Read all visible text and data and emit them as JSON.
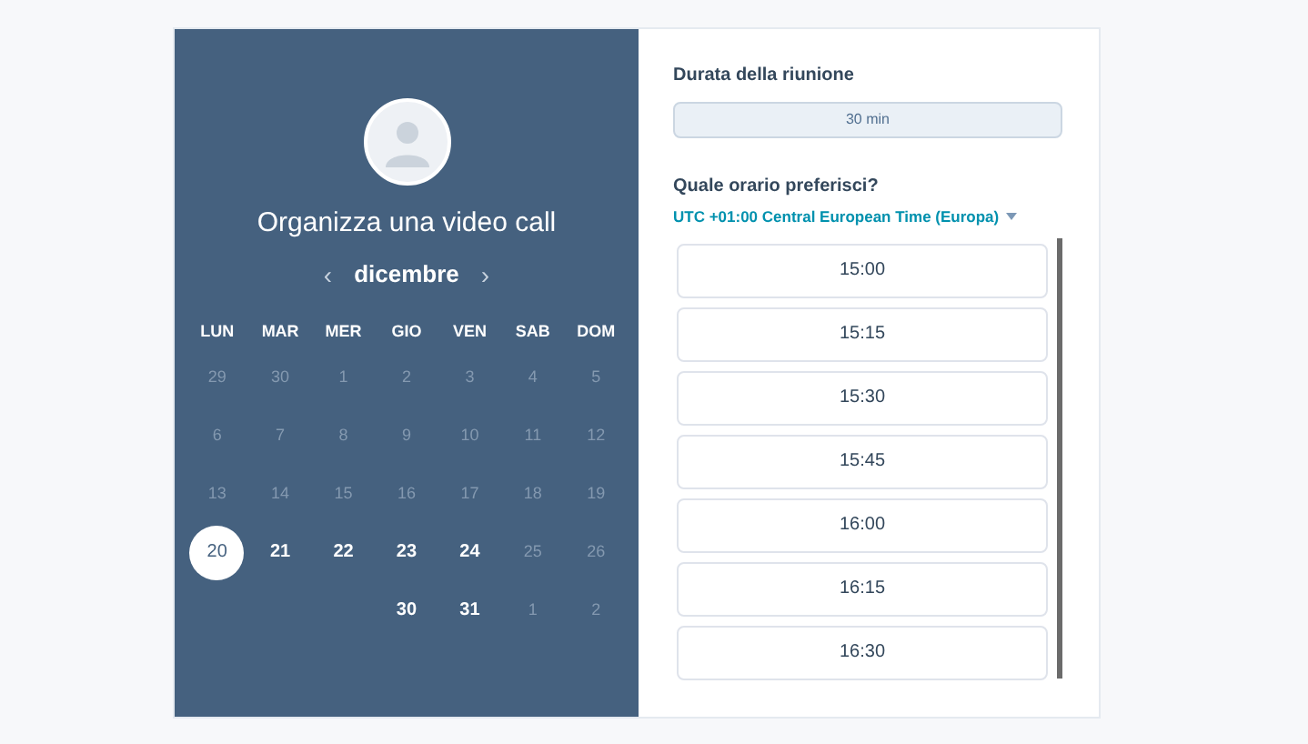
{
  "title": "Organizza una video call",
  "calendar": {
    "month": "dicembre",
    "prev": "‹",
    "next": "›",
    "weekdays": [
      "LUN",
      "MAR",
      "MER",
      "GIO",
      "VEN",
      "SAB",
      "DOM"
    ],
    "weeks": [
      [
        {
          "day": "29",
          "kind": "other"
        },
        {
          "day": "30",
          "kind": "other"
        },
        {
          "day": "1",
          "kind": "other"
        },
        {
          "day": "2",
          "kind": "other"
        },
        {
          "day": "3",
          "kind": "other"
        },
        {
          "day": "4",
          "kind": "other"
        },
        {
          "day": "5",
          "kind": "other"
        }
      ],
      [
        {
          "day": "6",
          "kind": "other"
        },
        {
          "day": "7",
          "kind": "other"
        },
        {
          "day": "8",
          "kind": "other"
        },
        {
          "day": "9",
          "kind": "other"
        },
        {
          "day": "10",
          "kind": "other"
        },
        {
          "day": "11",
          "kind": "other"
        },
        {
          "day": "12",
          "kind": "other"
        }
      ],
      [
        {
          "day": "13",
          "kind": "other"
        },
        {
          "day": "14",
          "kind": "other"
        },
        {
          "day": "15",
          "kind": "other"
        },
        {
          "day": "16",
          "kind": "other"
        },
        {
          "day": "17",
          "kind": "other"
        },
        {
          "day": "18",
          "kind": "other"
        },
        {
          "day": "19",
          "kind": "other"
        }
      ],
      [
        {
          "day": "20",
          "kind": "selected"
        },
        {
          "day": "21",
          "kind": "available"
        },
        {
          "day": "22",
          "kind": "available"
        },
        {
          "day": "23",
          "kind": "available"
        },
        {
          "day": "24",
          "kind": "available"
        },
        {
          "day": "25",
          "kind": "other"
        },
        {
          "day": "26",
          "kind": "other"
        }
      ],
      [
        {
          "day": "30",
          "kind": "available"
        },
        {
          "day": "31",
          "kind": "available"
        },
        {
          "day": "1",
          "kind": "other"
        },
        {
          "day": "2",
          "kind": "other"
        }
      ]
    ]
  },
  "duration": {
    "label": "Durata della riunione",
    "value": "30 min"
  },
  "time": {
    "label": "Quale orario preferisci?",
    "timezone": "UTC +01:00 Central European Time (Europa)",
    "slots": [
      "15:00",
      "15:15",
      "15:30",
      "15:45",
      "16:00",
      "16:15",
      "16:30"
    ]
  }
}
